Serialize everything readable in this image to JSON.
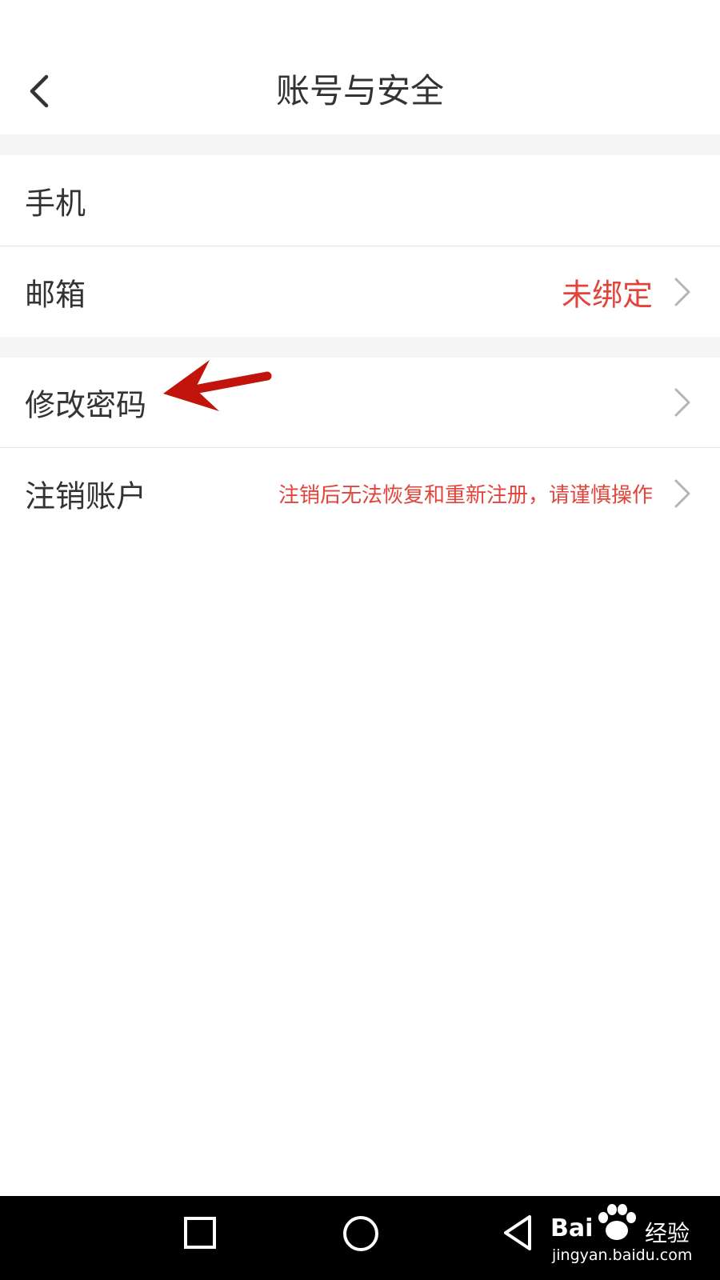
{
  "header": {
    "title": "账号与安全",
    "back_icon": "chevron-left-icon"
  },
  "sections": [
    {
      "rows": [
        {
          "id": "phone",
          "label": "手机",
          "value": ""
        },
        {
          "id": "email",
          "label": "邮箱",
          "value": "未绑定",
          "value_color": "#e0453b"
        }
      ]
    },
    {
      "rows": [
        {
          "id": "change-password",
          "label": "修改密码",
          "value": ""
        },
        {
          "id": "delete-account",
          "label": "注销账户",
          "value": "注销后无法恢复和重新注册，请谨慎操作",
          "value_color": "#e0453b"
        }
      ]
    }
  ],
  "annotation": {
    "icon": "red-arrow-icon",
    "color": "#c0140c"
  },
  "navbar": {
    "buttons": [
      "recent-apps-icon",
      "home-icon",
      "back-triangle-icon"
    ]
  },
  "watermark": {
    "brand_a": "Bai",
    "brand_b": "经验",
    "url": "jingyan.baidu.com"
  },
  "colors": {
    "accent_red": "#e0453b",
    "section_gap": "#f5f5f5",
    "text": "#333333",
    "chevron": "#b5b5b5"
  }
}
